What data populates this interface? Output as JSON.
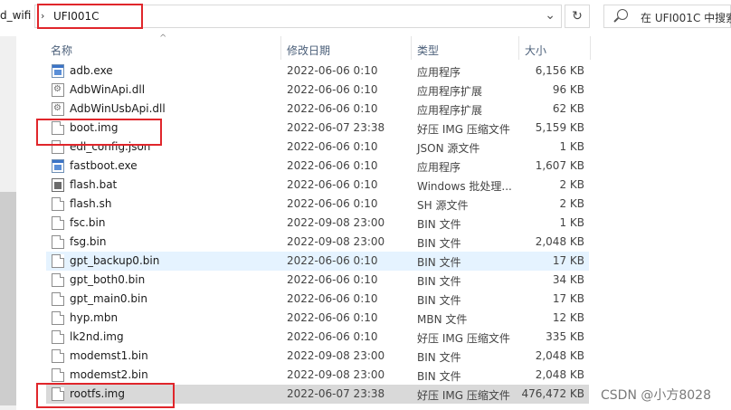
{
  "breadcrumb_left": "d_wifi",
  "address": {
    "path": "UFI001C"
  },
  "search": {
    "placeholder": "在 UFI001C 中搜索"
  },
  "columns": {
    "name": "名称",
    "date": "修改日期",
    "type": "类型",
    "size": "大小"
  },
  "files": [
    {
      "name": "adb.exe",
      "date": "2022-06-06 0:10",
      "type": "应用程序",
      "size": "6,156 KB",
      "icon": "exe-icon"
    },
    {
      "name": "AdbWinApi.dll",
      "date": "2022-06-06 0:10",
      "type": "应用程序扩展",
      "size": "96 KB",
      "icon": "dll-icon"
    },
    {
      "name": "AdbWinUsbApi.dll",
      "date": "2022-06-06 0:10",
      "type": "应用程序扩展",
      "size": "62 KB",
      "icon": "dll-icon"
    },
    {
      "name": "boot.img",
      "date": "2022-06-07 23:38",
      "type": "好压 IMG 压缩文件",
      "size": "5,159 KB",
      "icon": "file-icon"
    },
    {
      "name": "edl_config.json",
      "date": "2022-06-06 0:10",
      "type": "JSON 源文件",
      "size": "1 KB",
      "icon": "file-icon"
    },
    {
      "name": "fastboot.exe",
      "date": "2022-06-06 0:10",
      "type": "应用程序",
      "size": "1,607 KB",
      "icon": "exe-icon"
    },
    {
      "name": "flash.bat",
      "date": "2022-06-06 0:10",
      "type": "Windows 批处理...",
      "size": "2 KB",
      "icon": "batch-icon"
    },
    {
      "name": "flash.sh",
      "date": "2022-06-06 0:10",
      "type": "SH 源文件",
      "size": "2 KB",
      "icon": "file-icon"
    },
    {
      "name": "fsc.bin",
      "date": "2022-09-08 23:00",
      "type": "BIN 文件",
      "size": "1 KB",
      "icon": "file-icon"
    },
    {
      "name": "fsg.bin",
      "date": "2022-09-08 23:00",
      "type": "BIN 文件",
      "size": "2,048 KB",
      "icon": "file-icon"
    },
    {
      "name": "gpt_backup0.bin",
      "date": "2022-06-06 0:10",
      "type": "BIN 文件",
      "size": "17 KB",
      "icon": "file-icon"
    },
    {
      "name": "gpt_both0.bin",
      "date": "2022-06-06 0:10",
      "type": "BIN 文件",
      "size": "34 KB",
      "icon": "file-icon"
    },
    {
      "name": "gpt_main0.bin",
      "date": "2022-06-06 0:10",
      "type": "BIN 文件",
      "size": "17 KB",
      "icon": "file-icon"
    },
    {
      "name": "hyp.mbn",
      "date": "2022-06-06 0:10",
      "type": "MBN 文件",
      "size": "12 KB",
      "icon": "file-icon"
    },
    {
      "name": "lk2nd.img",
      "date": "2022-06-06 0:10",
      "type": "好压 IMG 压缩文件",
      "size": "335 KB",
      "icon": "file-icon"
    },
    {
      "name": "modemst1.bin",
      "date": "2022-09-08 23:00",
      "type": "BIN 文件",
      "size": "2,048 KB",
      "icon": "file-icon"
    },
    {
      "name": "modemst2.bin",
      "date": "2022-09-08 23:00",
      "type": "BIN 文件",
      "size": "2,048 KB",
      "icon": "file-icon"
    },
    {
      "name": "rootfs.img",
      "date": "2022-06-07 23:38",
      "type": "好压 IMG 压缩文件",
      "size": "476,472 KB",
      "icon": "file-icon"
    }
  ],
  "watermark": "CSDN @小方8028"
}
